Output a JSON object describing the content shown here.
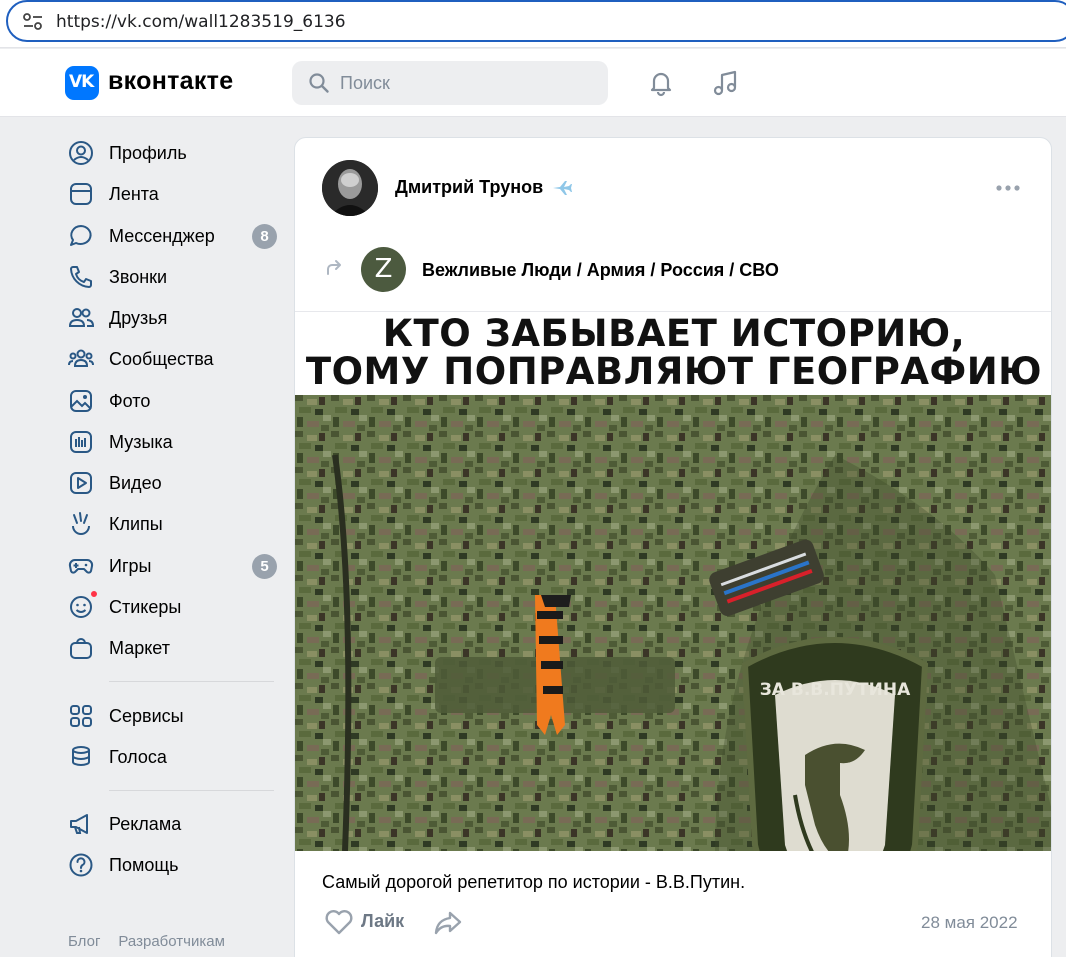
{
  "browser": {
    "url": "https://vk.com/wall1283519_6136"
  },
  "header": {
    "logo_mark": "VK",
    "logo_text": "вконтакте",
    "search_placeholder": "Поиск"
  },
  "sidebar": {
    "items": [
      {
        "label": "Профиль",
        "icon": "profile-icon"
      },
      {
        "label": "Лента",
        "icon": "feed-icon"
      },
      {
        "label": "Мессенджер",
        "icon": "messenger-icon",
        "badge": "8"
      },
      {
        "label": "Звонки",
        "icon": "phone-icon"
      },
      {
        "label": "Друзья",
        "icon": "friends-icon"
      },
      {
        "label": "Сообщества",
        "icon": "communities-icon"
      },
      {
        "label": "Фото",
        "icon": "photo-icon"
      },
      {
        "label": "Музыка",
        "icon": "music-icon"
      },
      {
        "label": "Видео",
        "icon": "video-icon"
      },
      {
        "label": "Клипы",
        "icon": "clips-icon"
      },
      {
        "label": "Игры",
        "icon": "games-icon",
        "badge": "5"
      },
      {
        "label": "Стикеры",
        "icon": "stickers-icon"
      },
      {
        "label": "Маркет",
        "icon": "market-icon"
      },
      {
        "label": "Сервисы",
        "icon": "services-icon"
      },
      {
        "label": "Голоса",
        "icon": "votes-icon"
      },
      {
        "label": "Реклама",
        "icon": "ads-icon"
      },
      {
        "label": "Помощь",
        "icon": "help-icon"
      }
    ],
    "footer": {
      "blog": "Блог",
      "developers": "Разработчикам"
    }
  },
  "post": {
    "author": "Дмитрий Трунов",
    "repost_source": "Вежливые Люди / Армия / Россия / СВО",
    "repost_avatar_letter": "Z",
    "image_text_line1": "КТО ЗАБЫВАЕТ ИСТОРИЮ,",
    "image_text_line2": "ТОМУ ПОПРАВЛЯЮТ ГЕОГРАФИЮ",
    "patch_text": "ЗА В.В.ПУТИНА",
    "caption": "Самый дорогой репетитор по истории - В.В.Путин.",
    "like_label": "Лайк",
    "date": "28 мая 2022"
  },
  "colors": {
    "accent": "#0077ff",
    "badge": "#99a2ad",
    "notify_dot": "#ff3347"
  }
}
